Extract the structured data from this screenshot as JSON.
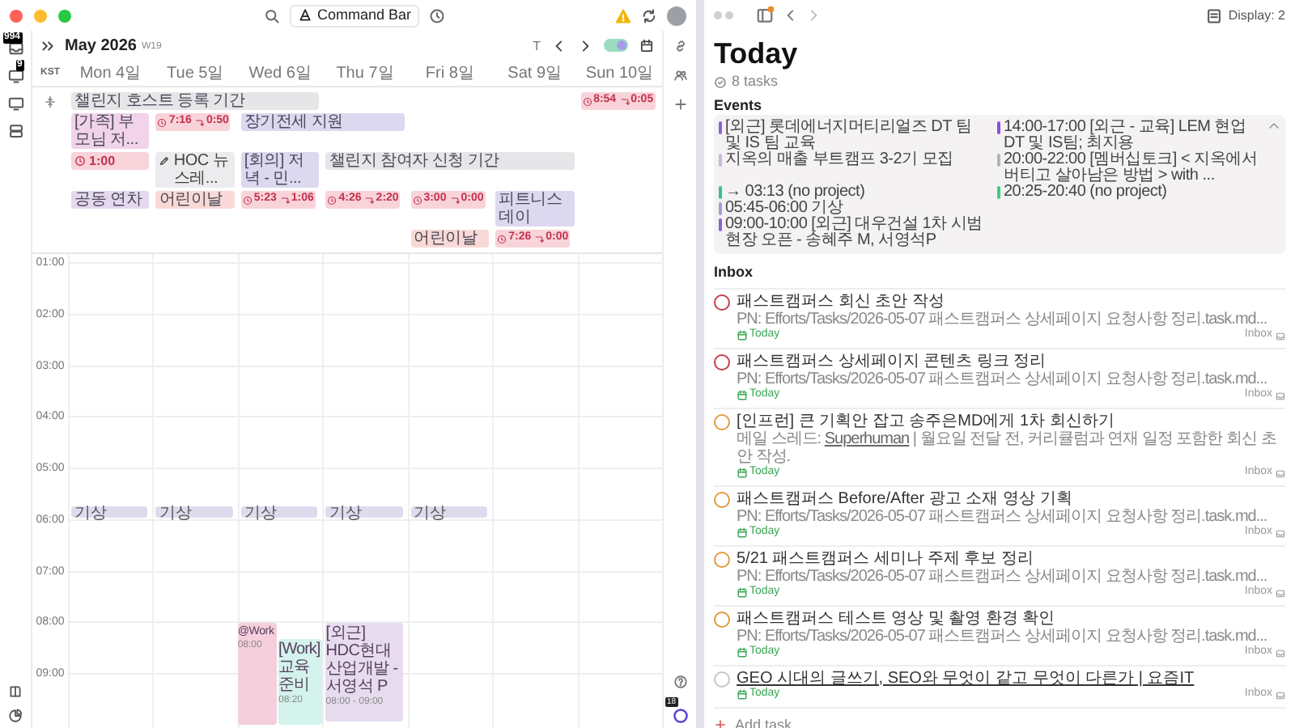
{
  "calendar": {
    "top_bar": {
      "command_bar": "Command Bar"
    },
    "rail_badges": [
      "994",
      "9"
    ],
    "header": {
      "month": "May 2026",
      "week": "W19",
      "today_button": "T",
      "toggle_on": true
    },
    "timezone": "KST",
    "days": [
      "Mon 4일",
      "Tue 5일",
      "Wed 6일",
      "Thu 7일",
      "Fri 8일",
      "Sat 9일",
      "Sun 10일"
    ],
    "all_day_events": [
      {
        "kind": "bar",
        "title": "챌린지 호스트 등록 기간",
        "color": "#e6e6e8"
      },
      {
        "kind": "sleep",
        "start": "8:54",
        "end": "0:05"
      },
      {
        "kind": "bar",
        "title": "[가족] 부모님 저...",
        "color": "#f1d3ea"
      },
      {
        "kind": "sleep",
        "start": "7:16",
        "end": "0:50"
      },
      {
        "kind": "bar",
        "title": "장기전세 지원",
        "color": "#dcd8f0"
      },
      {
        "kind": "timer",
        "duration": "1:00"
      },
      {
        "kind": "note",
        "title": "HOC 뉴스레..."
      },
      {
        "kind": "bar",
        "title": "[회의] 저녁 - 민...",
        "color": "#dcd8f0"
      },
      {
        "kind": "bar",
        "title": "챌린지 참여자 신청 기간",
        "color": "#e6e6e8"
      },
      {
        "kind": "bar",
        "title": "공동 연차",
        "color": "#e4d8ef"
      },
      {
        "kind": "bar",
        "title": "어린이날",
        "color": "#f9d9d6"
      },
      {
        "kind": "sleep",
        "start": "5:23",
        "end": "1:06"
      },
      {
        "kind": "sleep",
        "start": "4:26",
        "end": "2:20"
      },
      {
        "kind": "sleep",
        "start": "3:00",
        "end": "0:00"
      },
      {
        "kind": "bar",
        "title": "피트니스 데이",
        "color": "#dcd8f0"
      },
      {
        "kind": "bar",
        "title": "어린이날",
        "color": "#f9d9d6"
      },
      {
        "kind": "sleep",
        "start": "7:26",
        "end": "0:00"
      }
    ],
    "hours": [
      "01:00",
      "02:00",
      "03:00",
      "04:00",
      "05:00",
      "06:00",
      "07:00",
      "08:00",
      "09:00"
    ],
    "events": [
      {
        "title": "기상",
        "color": "#dddcee"
      },
      {
        "title": "기상",
        "color": "#dddcee"
      },
      {
        "title": "기상",
        "color": "#dddcee"
      },
      {
        "title": "기상",
        "color": "#dddcee"
      },
      {
        "title": "기상",
        "color": "#dddcee"
      },
      {
        "title": "@Work",
        "time": "08:00",
        "color": "#f5cfdc"
      },
      {
        "title": "[Work] 교육 준비",
        "time": "08:20",
        "color": "#d3f3ec"
      },
      {
        "title": "[외근] HDC현대산업개발 - 서영석 P",
        "time": "08:00 - 09:00",
        "color": "#e6dcee"
      }
    ],
    "assistant_badge": "18"
  },
  "today_panel": {
    "display": "Display: 2",
    "title": "Today",
    "task_count": "8 tasks",
    "events_heading": "Events",
    "events": [
      {
        "text": "[외근] 롯데에너지머티리얼즈 DT 팀 및 IS 팀 교육",
        "color": "#8a63d2"
      },
      {
        "text": "지옥의 매출 부트캠프 3-2기 모집",
        "color": "#c4b8e0"
      },
      {
        "text": "→ 03:13 (no project)",
        "color": "#3bbf8f"
      },
      {
        "text": "05:45-06:00 기상",
        "color": "#a89ad9"
      },
      {
        "text": "09:00-10:00 [외근] 대우건설 1차 시범현장 오픈 - 송혜주 M, 서영석P",
        "color": "#8a63d2"
      },
      {
        "text": "14:00-17:00 [외근 - 교육] LEM 현업 DT 및 IS팀; 최지용",
        "color": "#8a4fe0"
      },
      {
        "text": "20:00-22:00 [멤버십토크] < 지옥에서 버티고 살아남은 방법 > with ...",
        "color": "#b5b5b5"
      },
      {
        "text": "20:25-20:40 (no project)",
        "color": "#3fcf7a"
      }
    ],
    "inbox_heading": "Inbox",
    "tasks": [
      {
        "title": "패스트캠퍼스 회신 초안 작성",
        "color": "#c33d4f",
        "link": false,
        "note": "PN: Efforts/Tasks/2026-05-07 패스트캠퍼스 상세페이지 요청사항 정리.task.md...",
        "due": "Today",
        "list": "Inbox"
      },
      {
        "title": "패스트캠퍼스 상세페이지 콘텐츠 링크 정리",
        "color": "#c33d4f",
        "link": false,
        "note": "PN: Efforts/Tasks/2026-05-07 패스트캠퍼스 상세페이지 요청사항 정리.task.md...",
        "due": "Today",
        "list": "Inbox"
      },
      {
        "title": "[인프런] 큰 기획안 잡고 송주은MD에게 1차 회신하기",
        "color": "#e39a3e",
        "link": false,
        "note_before": "메일 스레드: ",
        "note_link": "Superhuman",
        "note_after": " | 월요일 전달 전, 커리큘럼과 연재 일정 포함한 회신 초안 작성.",
        "due": "Today",
        "list": "Inbox"
      },
      {
        "title": "패스트캠퍼스 Before/After 광고 소재 영상 기획",
        "color": "#e39a3e",
        "link": false,
        "note": "PN: Efforts/Tasks/2026-05-07 패스트캠퍼스 상세페이지 요청사항 정리.task.md...",
        "due": "Today",
        "list": "Inbox"
      },
      {
        "title": "5/21 패스트캠퍼스 세미나 주제 후보 정리",
        "color": "#e39a3e",
        "link": false,
        "note": "PN: Efforts/Tasks/2026-05-07 패스트캠퍼스 상세페이지 요청사항 정리.task.md...",
        "due": "Today",
        "list": "Inbox"
      },
      {
        "title": "패스트캠퍼스 테스트 영상 및 촬영 환경 확인",
        "color": "#e39a3e",
        "link": false,
        "note": "PN: Efforts/Tasks/2026-05-07 패스트캠퍼스 상세페이지 요청사항 정리.task.md...",
        "due": "Today",
        "list": "Inbox"
      },
      {
        "title": "GEO 시대의 글쓰기, SEO와 무엇이 같고 무엇이 다른가 | 요즘IT",
        "color": "#c4c4c4",
        "link": true,
        "due": "Today",
        "list": "Inbox"
      }
    ],
    "add_task": "Add task"
  }
}
